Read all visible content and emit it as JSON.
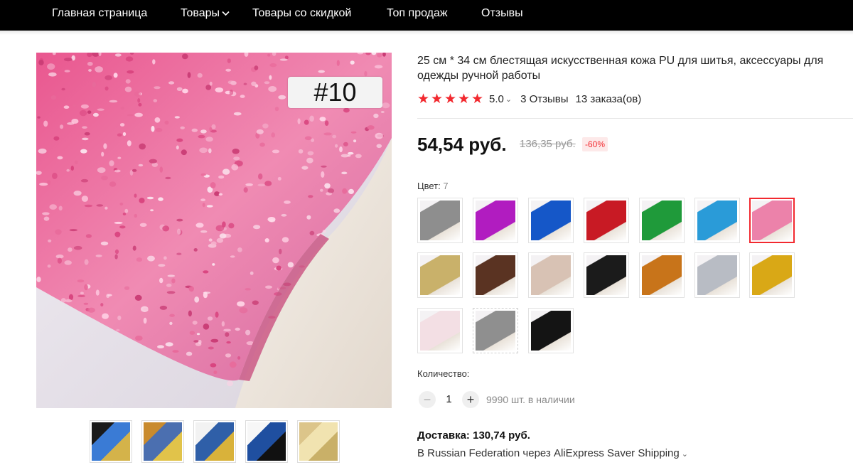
{
  "nav": {
    "items": [
      {
        "label": "Главная страница"
      },
      {
        "label": "Товары"
      },
      {
        "label": "Товары со скидкой"
      },
      {
        "label": "Топ продаж"
      },
      {
        "label": "Отзывы"
      }
    ]
  },
  "gallery": {
    "badge_text": "#10",
    "main_colors": {
      "sequin": "#e8699a",
      "sequin_light": "#f6b6d0",
      "backing": "#efe8e1",
      "bg": "#e9e4ea"
    },
    "thumbnails": [
      {
        "colors": [
          "#1a1a1a",
          "#3a7bd5",
          "#d4b34a"
        ]
      },
      {
        "colors": [
          "#c98b2e",
          "#4b6fb0",
          "#e1c34a"
        ]
      },
      {
        "colors": [
          "#f2f2f2",
          "#2f5fa8",
          "#d9b23a"
        ]
      },
      {
        "colors": [
          "#f7f7f7",
          "#1f4fa0",
          "#111111"
        ]
      },
      {
        "colors": [
          "#dcc58a",
          "#f1e3b0",
          "#c9b068"
        ]
      }
    ]
  },
  "product": {
    "title": "25 см * 34 см блестящая искусственная кожа PU для шитья, аксессуары для одежды ручной работы",
    "rating": {
      "stars": 5,
      "value": "5.0",
      "reviews": "3 Отзывы",
      "orders": "13 заказа(ов)"
    },
    "price": "54,54 руб.",
    "old_price": "136,35 руб.",
    "discount": "-60%"
  },
  "color": {
    "label": "Цвет:",
    "selected_value": "7",
    "swatches": [
      {
        "color": "#8e8e8e"
      },
      {
        "color": "#b11cc0"
      },
      {
        "color": "#1557c8"
      },
      {
        "color": "#c81a24"
      },
      {
        "color": "#1f9a3a"
      },
      {
        "color": "#2a9bd8"
      },
      {
        "color": "#ec82aa",
        "selected": true
      },
      {
        "color": "#c9b16a"
      },
      {
        "color": "#5a3322"
      },
      {
        "color": "#d8c2b4"
      },
      {
        "color": "#1b1b1b"
      },
      {
        "color": "#c8741a"
      },
      {
        "color": "#b8bcc4"
      },
      {
        "color": "#d9a816"
      },
      {
        "color": "#f3dfe4"
      },
      {
        "color": "#8f8f8f",
        "dashed": true
      },
      {
        "color": "#141414"
      }
    ]
  },
  "quantity": {
    "label": "Количество:",
    "minus": "−",
    "plus": "+",
    "value": "1",
    "stock": "9990 шт. в наличии"
  },
  "shipping": {
    "cost": "Доставка: 130,74 руб.",
    "detail": "В Russian Federation через AliExpress Saver Shipping"
  }
}
